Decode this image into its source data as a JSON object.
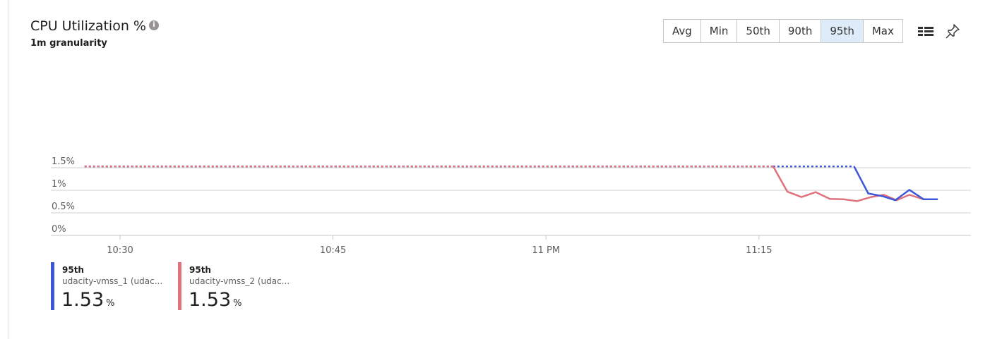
{
  "header": {
    "title": "CPU Utilization %",
    "info_icon": "info-icon",
    "granularity": "1m granularity"
  },
  "aggregations": {
    "options": [
      "Avg",
      "Min",
      "50th",
      "90th",
      "95th",
      "Max"
    ],
    "selected": "95th"
  },
  "toolbar": {
    "legend_icon": "grid-layout-icon",
    "pin_icon": "pin-icon"
  },
  "legend": [
    {
      "aggregation": "95th",
      "name": "udacity-vmss_1 (udac...",
      "value": "1.53",
      "unit": "%",
      "color": "#3e57d8"
    },
    {
      "aggregation": "95th",
      "name": "udacity-vmss_2 (udac...",
      "value": "1.53",
      "unit": "%",
      "color": "#e0727d"
    }
  ],
  "chart_data": {
    "type": "line",
    "y_ticks": [
      "1.5%",
      "1%",
      "0.5%",
      "0%"
    ],
    "y_tick_values": [
      1.5,
      1.0,
      0.5,
      0
    ],
    "ylim": [
      0,
      1.53
    ],
    "x_ticks": [
      "10:30",
      "10:45",
      "11 PM",
      "11:15"
    ],
    "x_tick_values": [
      630,
      645,
      660,
      675
    ],
    "xlim": [
      627.5,
      690
    ],
    "grid": true,
    "series": [
      {
        "name": "udacity-vmss_1 (udac...",
        "color": "#3e57d8",
        "dotted_segments": [
          [
            [
              627.5,
              1.53
            ],
            [
              676,
              1.53
            ]
          ],
          [
            [
              676,
              1.53
            ],
            [
              681.7,
              1.53
            ]
          ]
        ],
        "x": [
          681.7,
          682.7,
          683.7,
          684.6,
          685.6,
          686.6,
          687.6
        ],
        "y": [
          1.53,
          0.93,
          0.87,
          0.78,
          1.01,
          0.8,
          0.8
        ]
      },
      {
        "name": "udacity-vmss_2 (udac...",
        "color": "#e0727d",
        "dotted_segments": [
          [
            [
              627.5,
              1.53
            ],
            [
              676,
              1.53
            ]
          ]
        ],
        "x": [
          676,
          677,
          678,
          679,
          680,
          681,
          681.9,
          682.9,
          683.8,
          684.7,
          685.6,
          686.6,
          687.6
        ],
        "y": [
          1.53,
          0.97,
          0.85,
          0.96,
          0.81,
          0.8,
          0.76,
          0.85,
          0.9,
          0.78,
          0.9,
          0.8,
          0.8
        ]
      }
    ]
  }
}
